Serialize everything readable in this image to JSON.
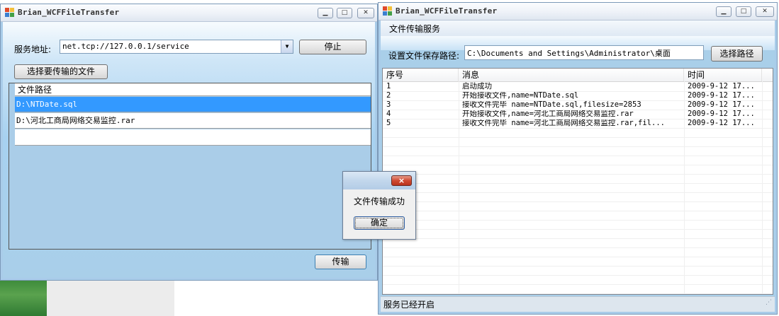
{
  "left_window": {
    "title": "Brian_WCFFileTransfer",
    "service_address_label": "服务地址:",
    "service_address_value": "net.tcp://127.0.0.1/service",
    "stop_button": "停止",
    "choose_files_button": "选择要传输的文件",
    "grid_header": "文件路径",
    "files": [
      "D:\\NTDate.sql",
      "D:\\河北工商局网络交易监控.rar"
    ],
    "transfer_button": "传输"
  },
  "right_window": {
    "title": "Brian_WCFFileTransfer",
    "menu": [
      "文件传输服务"
    ],
    "save_path_label": "设置文件保存路径:",
    "save_path_value": "C:\\Documents and Settings\\Administrator\\桌面",
    "choose_path_button": "选择路径",
    "columns": [
      "序号",
      "消息",
      "时间"
    ],
    "rows": [
      {
        "id": "1",
        "msg": "启动成功",
        "time": "2009-9-12 17..."
      },
      {
        "id": "2",
        "msg": "开始接收文件,name=NTDate.sql",
        "time": "2009-9-12 17..."
      },
      {
        "id": "3",
        "msg": "接收文件完毕 name=NTDate.sql,filesize=2853",
        "time": "2009-9-12 17..."
      },
      {
        "id": "4",
        "msg": "开始接收文件,name=河北工商局网络交易监控.rar",
        "time": "2009-9-12 17..."
      },
      {
        "id": "5",
        "msg": "接收文件完毕 name=河北工商局网络交易监控.rar,fil...",
        "time": "2009-9-12 17..."
      }
    ],
    "status": "服务已经开启"
  },
  "message_box": {
    "text": "文件传输成功",
    "ok_button": "确定",
    "close_glyph": "×"
  },
  "icons": {
    "minimize": "minimize-icon",
    "maximize": "maximize-icon",
    "close": "close-icon",
    "dropdown": "chevron-down-icon"
  }
}
